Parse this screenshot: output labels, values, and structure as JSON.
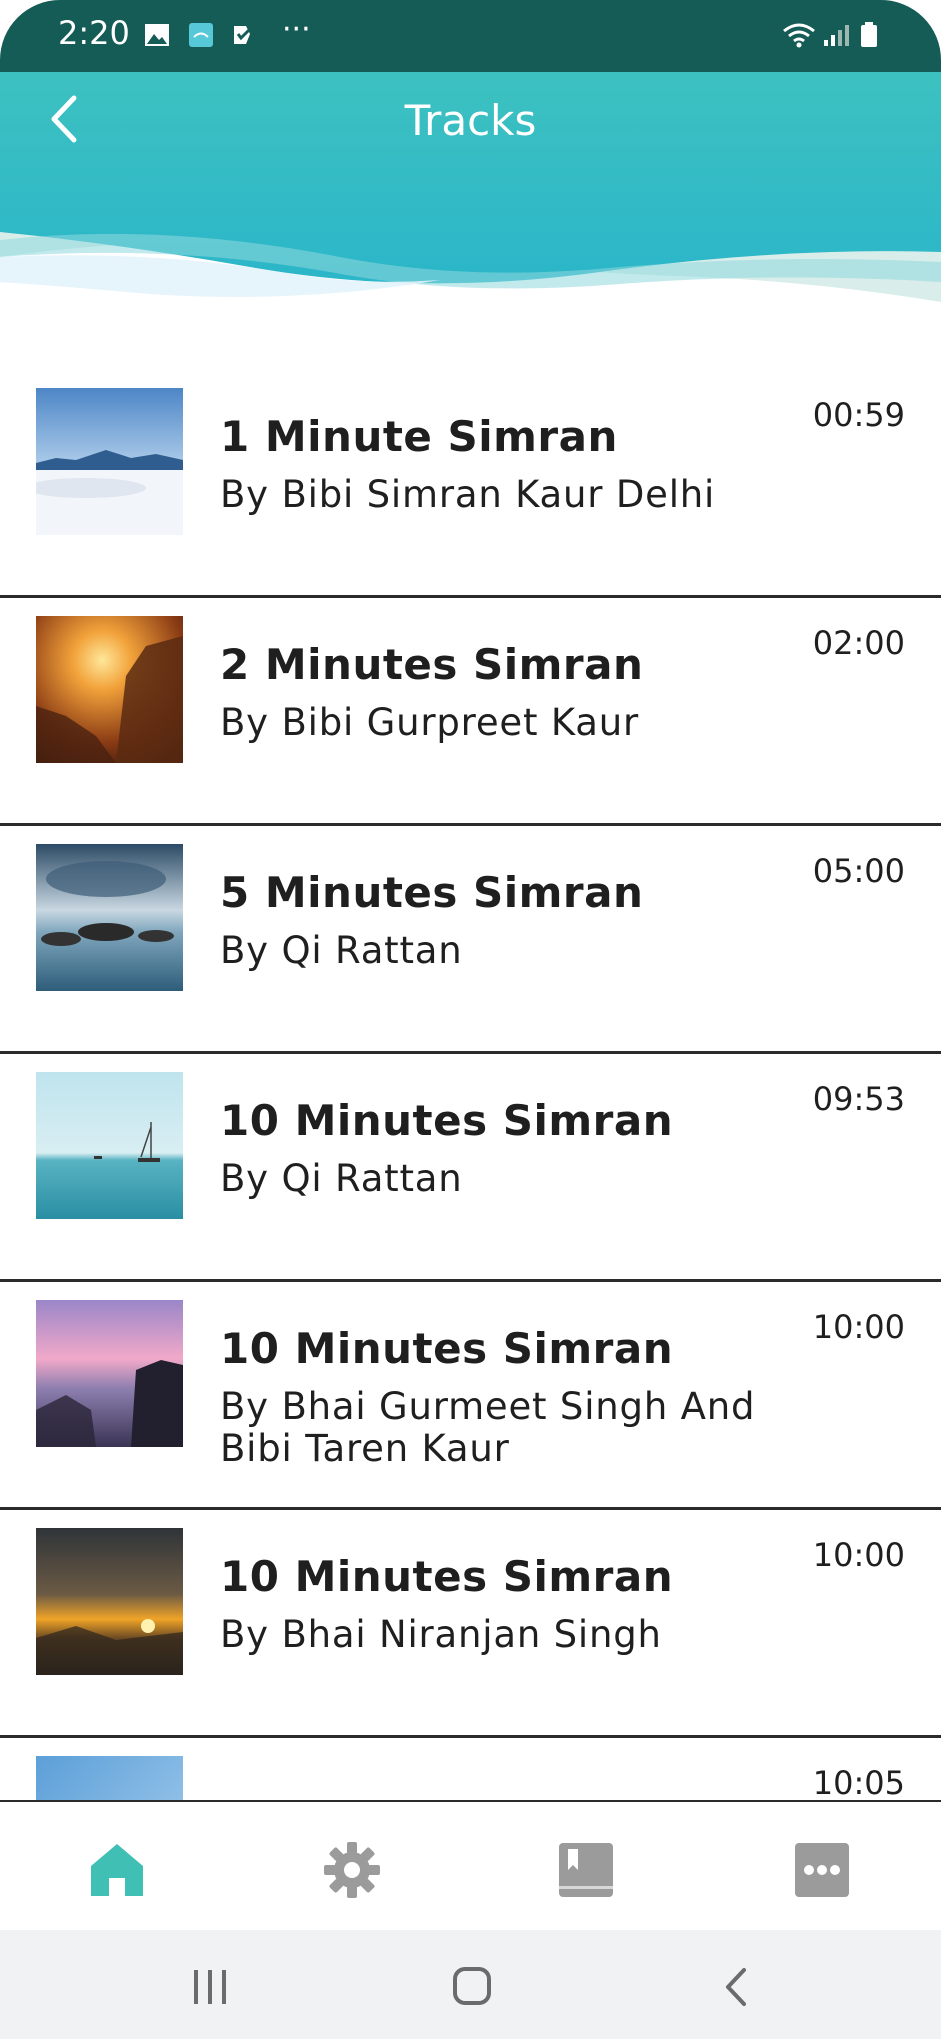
{
  "status_bar": {
    "time": "2:20",
    "more": "···"
  },
  "header": {
    "title": "Tracks"
  },
  "tracks": [
    {
      "title": "1 Minute Simran",
      "author": "By Bibi Simran Kaur Delhi",
      "duration": "00:59"
    },
    {
      "title": "2 Minutes Simran",
      "author": "By Bibi Gurpreet Kaur",
      "duration": "02:00"
    },
    {
      "title": "5 Minutes Simran",
      "author": "By Qi Rattan",
      "duration": "05:00"
    },
    {
      "title": "10 Minutes Simran",
      "author": "By Qi Rattan",
      "duration": "09:53"
    },
    {
      "title": "10 Minutes Simran",
      "author": "By Bhai Gurmeet Singh And Bibi Taren Kaur",
      "duration": "10:00"
    },
    {
      "title": "10 Minutes Simran",
      "author": "By Bhai Niranjan Singh",
      "duration": "10:00"
    },
    {
      "title": "",
      "author": "",
      "duration": "10:05"
    }
  ],
  "bottom_nav": {
    "items": [
      {
        "icon": "home-icon",
        "active": true
      },
      {
        "icon": "gear-icon",
        "active": false
      },
      {
        "icon": "bookmark-book-icon",
        "active": false
      },
      {
        "icon": "more-icon",
        "active": false
      }
    ]
  },
  "colors": {
    "accent": "#3dc1b8",
    "active_nav": "#40c0b4",
    "inactive_nav": "#9b9b9b",
    "status_bar": "#165c56"
  }
}
